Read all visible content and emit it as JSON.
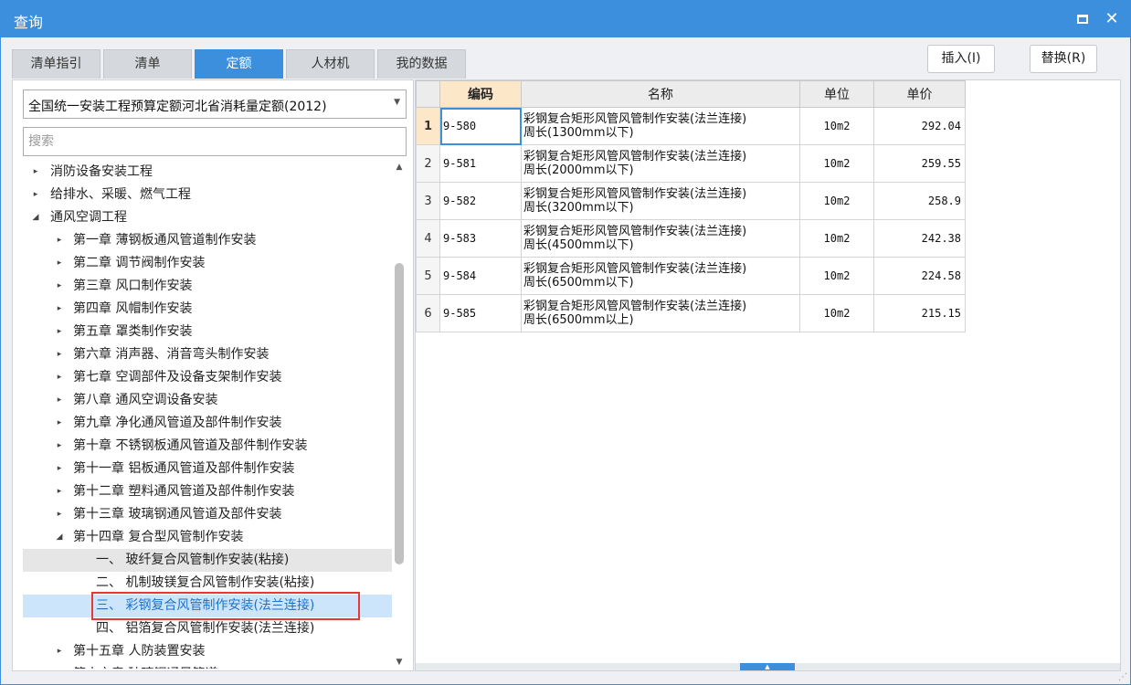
{
  "window": {
    "title": "查询"
  },
  "tabs": [
    "清单指引",
    "清单",
    "定额",
    "人材机",
    "我的数据"
  ],
  "active_tab": 2,
  "buttons": {
    "insert": "插入(I)",
    "replace": "替换(R)"
  },
  "quota_select": {
    "value": "全国统一安装工程预算定额河北省消耗量定额(2012)"
  },
  "search": {
    "placeholder": "搜索",
    "value": ""
  },
  "tree": [
    {
      "label": "消防设备安装工程",
      "level": 0,
      "toggle": "▸"
    },
    {
      "label": "给排水、采暖、燃气工程",
      "level": 0,
      "toggle": "▸"
    },
    {
      "label": "通风空调工程",
      "level": 0,
      "toggle": "◢"
    },
    {
      "label": "第一章 薄钢板通风管道制作安装",
      "level": 1,
      "toggle": "▸"
    },
    {
      "label": "第二章 调节阀制作安装",
      "level": 1,
      "toggle": "▸"
    },
    {
      "label": "第三章 风口制作安装",
      "level": 1,
      "toggle": "▸"
    },
    {
      "label": "第四章 风帽制作安装",
      "level": 1,
      "toggle": "▸"
    },
    {
      "label": "第五章 罩类制作安装",
      "level": 1,
      "toggle": "▸"
    },
    {
      "label": "第六章 消声器、消音弯头制作安装",
      "level": 1,
      "toggle": "▸"
    },
    {
      "label": "第七章 空调部件及设备支架制作安装",
      "level": 1,
      "toggle": "▸"
    },
    {
      "label": "第八章 通风空调设备安装",
      "level": 1,
      "toggle": "▸"
    },
    {
      "label": "第九章 净化通风管道及部件制作安装",
      "level": 1,
      "toggle": "▸"
    },
    {
      "label": "第十章 不锈钢板通风管道及部件制作安装",
      "level": 1,
      "toggle": "▸"
    },
    {
      "label": "第十一章 铝板通风管道及部件制作安装",
      "level": 1,
      "toggle": "▸"
    },
    {
      "label": "第十二章 塑料通风管道及部件制作安装",
      "level": 1,
      "toggle": "▸"
    },
    {
      "label": "第十三章 玻璃钢通风管道及部件安装",
      "level": 1,
      "toggle": "▸"
    },
    {
      "label": "第十四章 复合型风管制作安装",
      "level": 1,
      "toggle": "◢"
    },
    {
      "label": "一、 玻纤复合风管制作安装(粘接)",
      "level": 2,
      "toggle": "",
      "state": "hl"
    },
    {
      "label": "二、 机制玻镁复合风管制作安装(粘接)",
      "level": 2,
      "toggle": ""
    },
    {
      "label": "三、 彩钢复合风管制作安装(法兰连接)",
      "level": 2,
      "toggle": "",
      "state": "sel"
    },
    {
      "label": "四、 铝箔复合风管制作安装(法兰连接)",
      "level": 2,
      "toggle": ""
    },
    {
      "label": "第十五章 人防装置安装",
      "level": 1,
      "toggle": "▸"
    },
    {
      "label": "第十六章 玻璃钢通风管道",
      "level": 1,
      "toggle": "▸"
    }
  ],
  "table": {
    "headers": {
      "code": "编码",
      "name": "名称",
      "unit": "单位",
      "price": "单价"
    },
    "rows": [
      {
        "index": "1",
        "code": "9-580",
        "name1": "彩钢复合矩形风管风管制作安装(法兰连接)",
        "name2": "周长(1300mm以下)",
        "unit": "10m2",
        "price": "292.04"
      },
      {
        "index": "2",
        "code": "9-581",
        "name1": "彩钢复合矩形风管风管制作安装(法兰连接)",
        "name2": "周长(2000mm以下)",
        "unit": "10m2",
        "price": "259.55"
      },
      {
        "index": "3",
        "code": "9-582",
        "name1": "彩钢复合矩形风管风管制作安装(法兰连接)",
        "name2": "周长(3200mm以下)",
        "unit": "10m2",
        "price": "258.9"
      },
      {
        "index": "4",
        "code": "9-583",
        "name1": "彩钢复合矩形风管风管制作安装(法兰连接)",
        "name2": "周长(4500mm以下)",
        "unit": "10m2",
        "price": "242.38"
      },
      {
        "index": "5",
        "code": "9-584",
        "name1": "彩钢复合矩形风管风管制作安装(法兰连接)",
        "name2": "周长(6500mm以下)",
        "unit": "10m2",
        "price": "224.58"
      },
      {
        "index": "6",
        "code": "9-585",
        "name1": "彩钢复合矩形风管风管制作安装(法兰连接)",
        "name2": "周长(6500mm以上)",
        "unit": "10m2",
        "price": "215.15"
      }
    ]
  },
  "colors": {
    "accent": "#3b8fdc",
    "highlight_header": "#fde7c9",
    "selection_box": "#e53935",
    "selected_row": "#cde5fb"
  },
  "icons": {
    "maximize": "maximize-icon",
    "close": "close-icon",
    "dropdown": "chevron-down-icon"
  }
}
